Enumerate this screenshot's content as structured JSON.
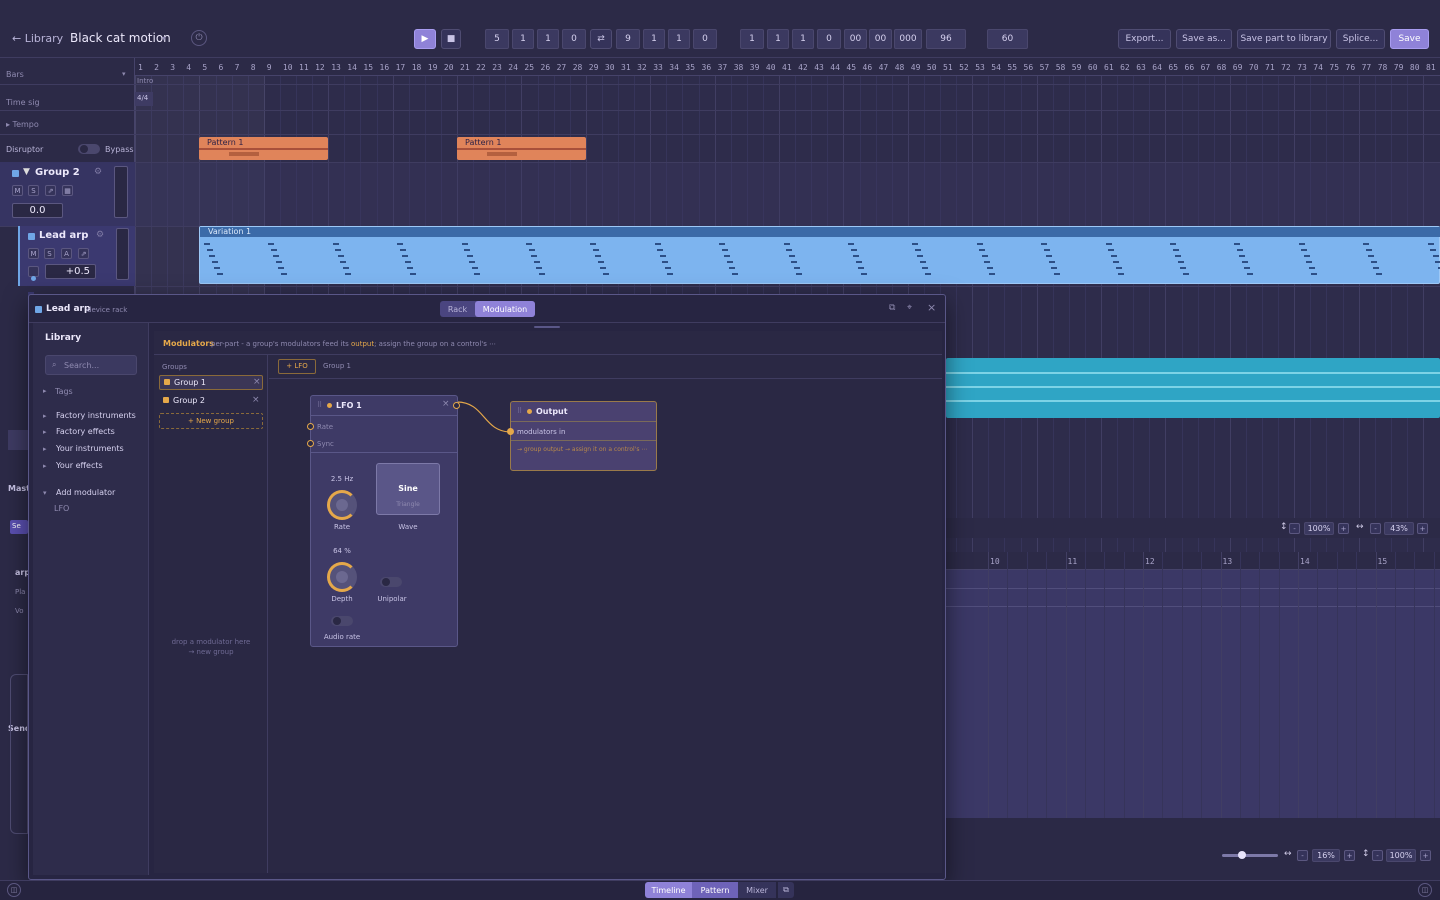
{
  "header": {
    "back_label": "← Library",
    "project_title": "Black cat motion",
    "title_caret": "▾",
    "power_icon": "⏻"
  },
  "transport": {
    "play": "▶",
    "stop": "■",
    "position": [
      "5",
      "1",
      "1",
      "0"
    ],
    "loop_icon": "⇄",
    "loop_end": [
      "9",
      "1",
      "1",
      "0"
    ],
    "time": [
      "1",
      "1",
      "1",
      "0",
      "00",
      "00",
      "000"
    ],
    "ppq": "96",
    "bpm": "60"
  },
  "actions": {
    "export": "Export...",
    "save_as": "Save as...",
    "save_part": "Save part to library",
    "splice": "Splice...",
    "save": "Save"
  },
  "ruler": {
    "bars": [
      "1",
      "2",
      "3",
      "4",
      "5",
      "6",
      "7",
      "8",
      "9",
      "10",
      "11",
      "12",
      "13",
      "14",
      "15",
      "16",
      "17",
      "18",
      "19",
      "20",
      "21",
      "22",
      "23",
      "24",
      "25",
      "26",
      "27",
      "28",
      "29",
      "30",
      "31",
      "32",
      "33",
      "34",
      "35",
      "36",
      "37",
      "38",
      "39",
      "40",
      "41",
      "42",
      "43",
      "44",
      "45",
      "46",
      "47",
      "48",
      "49",
      "50",
      "51",
      "52",
      "53",
      "54",
      "55",
      "56",
      "57",
      "58",
      "59",
      "60",
      "61",
      "62",
      "63",
      "64",
      "65",
      "66",
      "67",
      "68",
      "69",
      "70",
      "71",
      "72",
      "73",
      "74",
      "75",
      "76",
      "77",
      "78",
      "79",
      "80",
      "81"
    ],
    "lower_bars": [
      "10",
      "11",
      "12",
      "13",
      "14",
      "15"
    ]
  },
  "rows": {
    "bars_label": "Bars",
    "timesig_label": "Time sig",
    "timesig_value": "4/4",
    "tempo_label": "▸ Tempo",
    "intro_marker": "Intro",
    "disruptor_label": "Disruptor",
    "bypass_label": "Bypass"
  },
  "tracks": {
    "group2": {
      "name": "Group 2",
      "volume": "0.0",
      "buttons": [
        "M",
        "S",
        "⇗",
        "▦"
      ]
    },
    "lead_arp": {
      "name": "Lead arp",
      "pan": "+0.5",
      "buttons": [
        "M",
        "S",
        "A",
        "⇗"
      ]
    },
    "partial_labels": [
      "Send",
      "Mast",
      "arp",
      "Pla",
      "Vo"
    ],
    "partial_initials": [
      "H",
      "M",
      "M",
      "Se",
      "C",
      "L"
    ]
  },
  "clips": {
    "pattern1a": "Pattern 1",
    "pattern1b": "Pattern 1",
    "variation": "Variation 1"
  },
  "zoom": {
    "upper_v": "100%",
    "upper_h": "43%",
    "lower_h": "16%",
    "lower_v": "100%",
    "minus": "-",
    "plus": "+",
    "v_icon": "↕",
    "h_icon": "↔"
  },
  "panel": {
    "track_name": "Lead arp",
    "subtitle": "device rack",
    "tab_rack": "Rack",
    "tab_modulation": "Modulation",
    "popout_icon": "⧉",
    "pin_icon": "⌖",
    "close_icon": "×",
    "library_title": "Library",
    "search_placeholder": "Search...",
    "search_icon": "⌕",
    "tags": "Tags",
    "tree": [
      "Factory instruments",
      "Factory effects",
      "Your instruments",
      "Your effects"
    ],
    "add_modulator": "Add modulator",
    "lfo_item": "LFO",
    "modulators_title": "Modulators",
    "modulators_desc_1": "per-part - a group's modulators feed its ",
    "modulators_desc_output": "output",
    "modulators_desc_2": "; assign the group on a control's ⋯",
    "groups_title": "Groups",
    "groups": [
      "Group 1",
      "Group 2"
    ],
    "new_group": "+ New group",
    "drop_hint_1": "drop a modulator here",
    "drop_hint_2": "→ new group",
    "add_lfo": "+ LFO",
    "group_crumb": "Group 1",
    "lfo": {
      "title": "LFO 1",
      "close": "×",
      "rate_port": "Rate",
      "sync_port": "Sync",
      "rate_value": "2.5 Hz",
      "rate_label": "Rate",
      "wave_selected": "Sine",
      "wave_next": "Triangle",
      "wave_label": "Wave",
      "depth_value": "64 %",
      "depth_label": "Depth",
      "unipolar_label": "Unipolar",
      "audio_rate_label": "Audio rate"
    },
    "output": {
      "title": "Output",
      "port_label": "modulators in",
      "hint": "→ group output → assign it on a control's ⋯"
    }
  },
  "bottom": {
    "tab_timeline": "Timeline",
    "tab_pattern": "Pattern",
    "tab_mixer": "Mixer",
    "popout": "⧉"
  },
  "colors": {
    "accent": "#9d8fe0",
    "clip_orange": "#e0845a",
    "clip_blue": "#7db4ef",
    "clip_teal": "#2fa5c5",
    "modulation_gold": "#e5a84a"
  }
}
